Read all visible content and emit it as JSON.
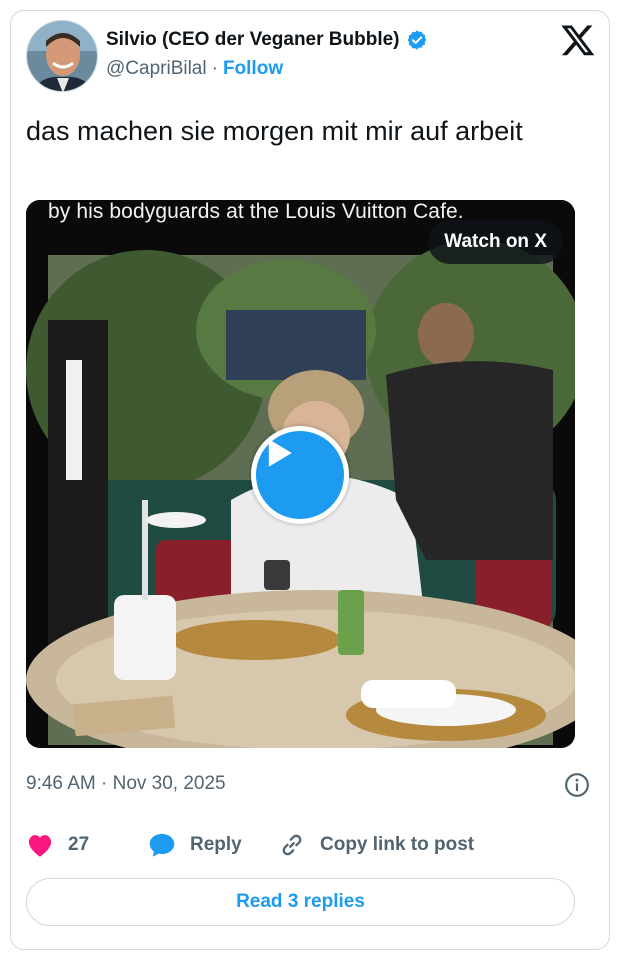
{
  "author": {
    "display_name": "Silvio (CEO der Veganer Bubble)",
    "handle": "@CapriBilal",
    "separator": "·",
    "follow_label": "Follow",
    "verified_icon": "verified-badge-icon"
  },
  "tweet": {
    "text": "das machen sie morgen mit mir auf arbeit",
    "timestamp": "9:46 AM · Nov 30, 2025"
  },
  "media": {
    "caption": "by his bodyguards at the Louis Vuitton Cafe.",
    "watch_label": "Watch on X",
    "play_icon": "play-icon"
  },
  "actions": {
    "like_count": "27",
    "reply_label": "Reply",
    "copy_link_label": "Copy link to post"
  },
  "footer": {
    "read_replies_label": "Read 3 replies"
  },
  "colors": {
    "accent": "#1d9bf0",
    "like": "#f91880",
    "text_primary": "#0f1419",
    "text_secondary": "#536471",
    "border": "#cfd9de"
  }
}
